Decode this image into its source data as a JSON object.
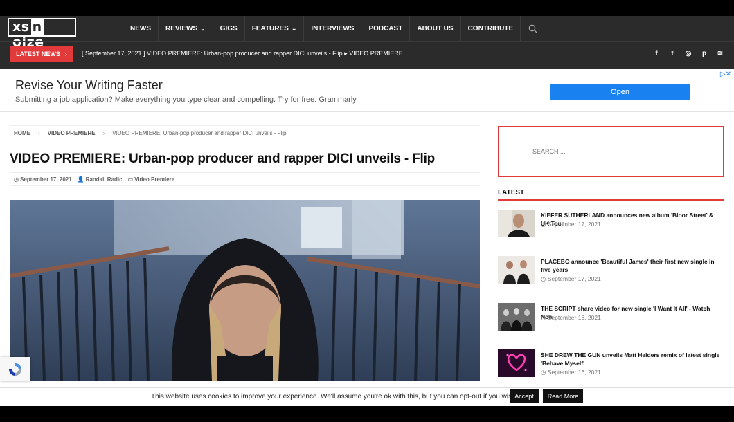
{
  "header": {
    "logo_text": "xsnoize",
    "nav": [
      {
        "label": "NEWS",
        "dropdown": false
      },
      {
        "label": "REVIEWS",
        "dropdown": true
      },
      {
        "label": "GIGS",
        "dropdown": false
      },
      {
        "label": "FEATURES",
        "dropdown": true
      },
      {
        "label": "INTERVIEWS",
        "dropdown": false
      },
      {
        "label": "PODCAST",
        "dropdown": false
      },
      {
        "label": "ABOUT US",
        "dropdown": false
      },
      {
        "label": "CONTRIBUTE",
        "dropdown": false
      }
    ],
    "latest_news_label": "LATEST NEWS",
    "ticker": "[ September 17, 2021 ]  VIDEO PREMIERE: Urban-pop producer and rapper DICI unveils - Flip  ▸  VIDEO PREMIERE",
    "socials": [
      "facebook-icon",
      "twitter-icon",
      "instagram-icon",
      "pinterest-icon",
      "rss-icon"
    ],
    "social_glyphs": [
      "f",
      "t",
      "◎",
      "p",
      "≋"
    ]
  },
  "ad": {
    "title": "Revise Your Writing Faster",
    "subtitle": "Submitting a job application? Make everything you type clear and compelling. Try for free. Grammarly",
    "cta": "Open"
  },
  "breadcrumb": {
    "home": "HOME",
    "category": "VIDEO PREMIERE",
    "current": "VIDEO PREMIERE: Urban-pop producer and rapper DICI unveils - Flip"
  },
  "post": {
    "title": "VIDEO PREMIERE: Urban-pop producer and rapper DICI unveils - Flip",
    "date": "September 17, 2021",
    "author": "Randall Radic",
    "category": "Video Premiere"
  },
  "sidebar": {
    "search_placeholder": "SEARCH ...",
    "latest_heading": "LATEST",
    "latest": [
      {
        "title": "KIEFER SUTHERLAND announces new album 'Bloor Street' & UK Tour",
        "date": "September 17, 2021"
      },
      {
        "title": "PLACEBO announce 'Beautiful James' their first new single in five years",
        "date": "September 17, 2021"
      },
      {
        "title": "THE SCRIPT share video for new single 'I Want It All' - Watch Now",
        "date": "September 16, 2021"
      },
      {
        "title": "SHE DREW THE GUN unveils Matt Helders remix of latest single 'Behave Myself'",
        "date": "September 16, 2021"
      }
    ]
  },
  "cookie": {
    "text": "This website uses cookies to improve your experience. We'll assume you're ok with this, but you can opt-out if you wish.",
    "accept": "Accept",
    "read_more": "Read More"
  },
  "colors": {
    "accent": "#e23a3a",
    "header_bg": "#2b2b2b",
    "ad_button": "#1a82f0"
  }
}
